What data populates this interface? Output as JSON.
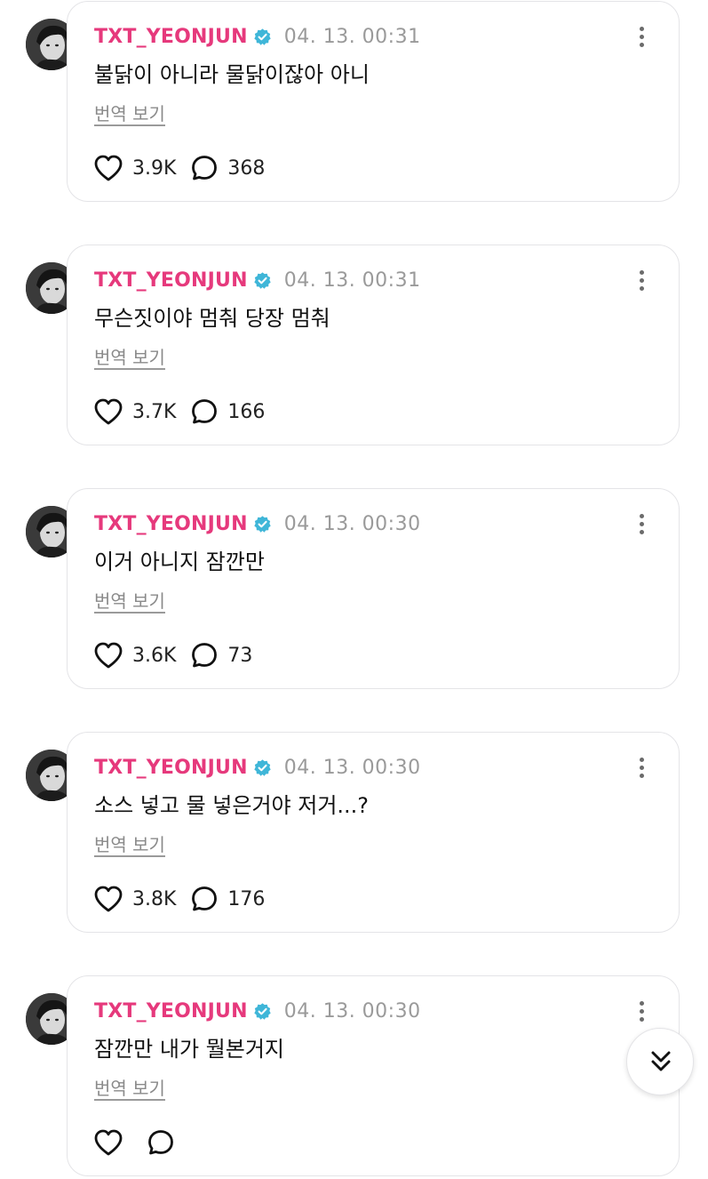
{
  "colors": {
    "username": "#e6397c",
    "verified_badge": "#3fb6d8",
    "timestamp": "#9a9a9a",
    "card_border": "#e4e4e7"
  },
  "posts": [
    {
      "username": "TXT_YEONJUN",
      "timestamp": "04. 13. 00:31",
      "text": "불닭이 아니라 물닭이잖아 아니",
      "translate_label": "번역 보기",
      "likes": "3.9K",
      "comments": "368"
    },
    {
      "username": "TXT_YEONJUN",
      "timestamp": "04. 13. 00:31",
      "text": "무슨짓이야 멈춰 당장 멈춰",
      "translate_label": "번역 보기",
      "likes": "3.7K",
      "comments": "166"
    },
    {
      "username": "TXT_YEONJUN",
      "timestamp": "04. 13. 00:30",
      "text": "이거 아니지 잠깐만",
      "translate_label": "번역 보기",
      "likes": "3.6K",
      "comments": "73"
    },
    {
      "username": "TXT_YEONJUN",
      "timestamp": "04. 13. 00:30",
      "text": "소스 넣고 물 넣은거야 저거...?",
      "translate_label": "번역 보기",
      "likes": "3.8K",
      "comments": "176"
    },
    {
      "username": "TXT_YEONJUN",
      "timestamp": "04. 13. 00:30",
      "text": "잠깐만 내가 뭘본거지",
      "translate_label": "번역 보기",
      "likes": "",
      "comments": ""
    }
  ],
  "icons": {
    "verified": "verified-badge-icon",
    "more": "more-vertical-icon",
    "like": "heart-icon",
    "comment": "comment-bubble-icon",
    "scroll": "double-chevron-down-icon"
  }
}
